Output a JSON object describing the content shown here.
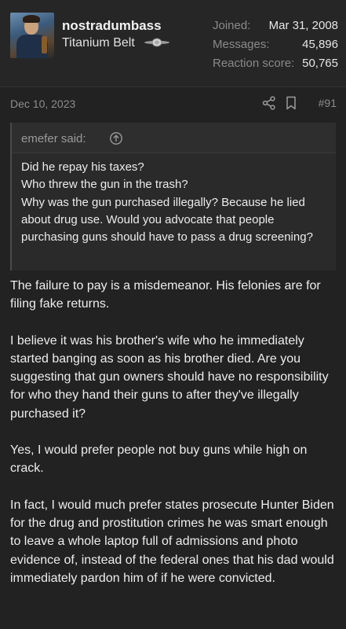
{
  "user": {
    "username": "nostradumbass",
    "title": "Titanium Belt",
    "stats": [
      {
        "label": "Joined:",
        "value": "Mar 31, 2008"
      },
      {
        "label": "Messages:",
        "value": "45,896"
      },
      {
        "label": "Reaction score:",
        "value": "50,765"
      }
    ]
  },
  "post": {
    "date": "Dec 10, 2023",
    "number": "#91"
  },
  "quote": {
    "author": "emefer said:",
    "lines": [
      "Did he repay his taxes?",
      "Who threw the gun in the trash?",
      "Why was the gun purchased illegally? Because he lied about drug use. Would you advocate that people purchasing guns should have to pass a drug screening?"
    ]
  },
  "message": {
    "paragraphs": [
      "The failure to pay is a misdemeanor. His felonies are for filing fake returns.",
      "I believe it was his brother's wife who he immediately started banging as soon as his brother died. Are you suggesting that gun owners should have no responsibility for who they hand their guns to after they've illegally purchased it?",
      "Yes, I would prefer people not buy guns while high on crack.",
      "In fact, I would much prefer states prosecute Hunter Biden for the drug and prostitution crimes he was smart enough to leave a whole laptop full of admissions and photo evidence of, instead of the federal ones that his dad would immediately pardon him of if he were convicted."
    ]
  },
  "colors": {
    "background": "#222222",
    "text": "#ededed",
    "muted": "#8c8c8c",
    "quote_bg": "#2a2a2a"
  }
}
